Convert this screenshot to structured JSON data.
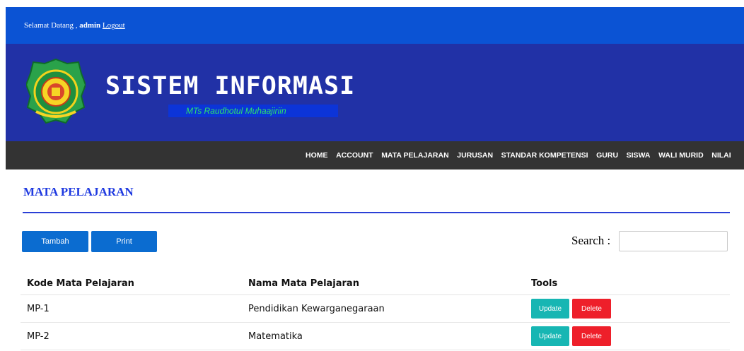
{
  "topbar": {
    "greeting": "Selamat Datang , ",
    "user": "admin",
    "logout": "Logout"
  },
  "banner": {
    "title": "SISTEM INFORMASI",
    "subtitle": "MTs Raudhotul Muhaajiriin"
  },
  "nav": [
    "HOME",
    "ACCOUNT",
    "MATA PELAJARAN",
    "JURUSAN",
    "STANDAR KOMPETENSI",
    "GURU",
    "SISWA",
    "WALI MURID",
    "NILAI"
  ],
  "page": {
    "title": "MATA PELAJARAN",
    "add_label": "Tambah",
    "print_label": "Print",
    "search_label": "Search :",
    "search_value": ""
  },
  "table": {
    "headers": [
      "Kode Mata Pelajaran",
      "Nama Mata Pelajaran",
      "Tools"
    ],
    "rows": [
      {
        "kode": "MP-1",
        "nama": "Pendidikan Kewarganegaraan"
      },
      {
        "kode": "MP-2",
        "nama": "Matematika"
      }
    ],
    "update_label": "Update",
    "delete_label": "Delete"
  },
  "colors": {
    "topbar": "#0b53d4",
    "banner": "#2131a6",
    "nav": "#333333",
    "accent": "#1f3ae0",
    "update": "#17b6b3",
    "delete": "#ee1f2a"
  }
}
